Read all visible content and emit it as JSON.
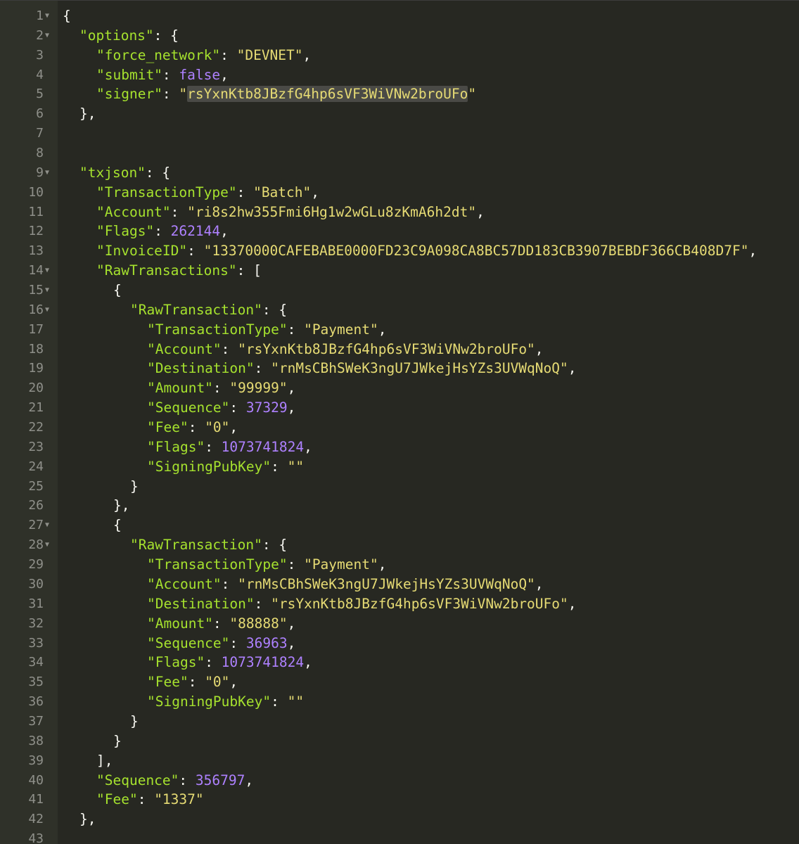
{
  "editor": {
    "theme_colors": {
      "background": "#272822",
      "gutter": "#2f3129",
      "line_number": "#8f908a",
      "key": "#a6e22e",
      "string": "#e6db74",
      "number": "#ae81ff",
      "punctuation": "#f8f8f2",
      "selection": "#4a4a46"
    },
    "lines": [
      {
        "n": "1",
        "fold": true,
        "indent": 0,
        "tokens": [
          {
            "t": "p",
            "v": "{"
          }
        ]
      },
      {
        "n": "2",
        "fold": true,
        "indent": 1,
        "tokens": [
          {
            "t": "k",
            "v": "\"options\""
          },
          {
            "t": "p",
            "v": ": {"
          }
        ]
      },
      {
        "n": "3",
        "indent": 2,
        "tokens": [
          {
            "t": "k",
            "v": "\"force_network\""
          },
          {
            "t": "p",
            "v": ": "
          },
          {
            "t": "s",
            "v": "\"DEVNET\""
          },
          {
            "t": "p",
            "v": ","
          }
        ]
      },
      {
        "n": "4",
        "indent": 2,
        "tokens": [
          {
            "t": "k",
            "v": "\"submit\""
          },
          {
            "t": "p",
            "v": ": "
          },
          {
            "t": "n",
            "v": "false"
          },
          {
            "t": "p",
            "v": ","
          }
        ]
      },
      {
        "n": "5",
        "indent": 2,
        "tokens": [
          {
            "t": "k",
            "v": "\"signer\""
          },
          {
            "t": "p",
            "v": ": "
          },
          {
            "t": "s",
            "v": "\""
          },
          {
            "t": "s",
            "v": "rsYxnKtb8JBzfG4hp6sVF3WiVNw2broUFo",
            "hl": true
          },
          {
            "t": "s",
            "v": "\""
          }
        ]
      },
      {
        "n": "6",
        "indent": 1,
        "tokens": [
          {
            "t": "p",
            "v": "},"
          }
        ]
      },
      {
        "n": "7",
        "indent": 0,
        "tokens": []
      },
      {
        "n": "8",
        "indent": 0,
        "tokens": []
      },
      {
        "n": "9",
        "fold": true,
        "indent": 1,
        "tokens": [
          {
            "t": "k",
            "v": "\"txjson\""
          },
          {
            "t": "p",
            "v": ": {"
          }
        ]
      },
      {
        "n": "10",
        "indent": 2,
        "tokens": [
          {
            "t": "k",
            "v": "\"TransactionType\""
          },
          {
            "t": "p",
            "v": ": "
          },
          {
            "t": "s",
            "v": "\"Batch\""
          },
          {
            "t": "p",
            "v": ","
          }
        ]
      },
      {
        "n": "11",
        "indent": 2,
        "tokens": [
          {
            "t": "k",
            "v": "\"Account\""
          },
          {
            "t": "p",
            "v": ": "
          },
          {
            "t": "s",
            "v": "\"ri8s2hw355Fmi6Hg1w2wGLu8zKmA6h2dt\""
          },
          {
            "t": "p",
            "v": ","
          }
        ]
      },
      {
        "n": "12",
        "indent": 2,
        "tokens": [
          {
            "t": "k",
            "v": "\"Flags\""
          },
          {
            "t": "p",
            "v": ": "
          },
          {
            "t": "n",
            "v": "262144"
          },
          {
            "t": "p",
            "v": ","
          }
        ]
      },
      {
        "n": "13",
        "indent": 2,
        "tokens": [
          {
            "t": "k",
            "v": "\"InvoiceID\""
          },
          {
            "t": "p",
            "v": ": "
          },
          {
            "t": "s",
            "v": "\"13370000CAFEBABE0000FD23C9A098CA8BC57DD183CB3907BEBDF366CB408D7F\""
          },
          {
            "t": "p",
            "v": ","
          }
        ]
      },
      {
        "n": "14",
        "fold": true,
        "indent": 2,
        "tokens": [
          {
            "t": "k",
            "v": "\"RawTransactions\""
          },
          {
            "t": "p",
            "v": ": ["
          }
        ]
      },
      {
        "n": "15",
        "fold": true,
        "indent": 3,
        "tokens": [
          {
            "t": "p",
            "v": "{"
          }
        ]
      },
      {
        "n": "16",
        "fold": true,
        "indent": 4,
        "tokens": [
          {
            "t": "k",
            "v": "\"RawTransaction\""
          },
          {
            "t": "p",
            "v": ": {"
          }
        ]
      },
      {
        "n": "17",
        "indent": 5,
        "tokens": [
          {
            "t": "k",
            "v": "\"TransactionType\""
          },
          {
            "t": "p",
            "v": ": "
          },
          {
            "t": "s",
            "v": "\"Payment\""
          },
          {
            "t": "p",
            "v": ","
          }
        ]
      },
      {
        "n": "18",
        "indent": 5,
        "tokens": [
          {
            "t": "k",
            "v": "\"Account\""
          },
          {
            "t": "p",
            "v": ": "
          },
          {
            "t": "s",
            "v": "\"rsYxnKtb8JBzfG4hp6sVF3WiVNw2broUFo\""
          },
          {
            "t": "p",
            "v": ","
          }
        ]
      },
      {
        "n": "19",
        "indent": 5,
        "tokens": [
          {
            "t": "k",
            "v": "\"Destination\""
          },
          {
            "t": "p",
            "v": ": "
          },
          {
            "t": "s",
            "v": "\"rnMsCBhSWeK3ngU7JWkejHsYZs3UVWqNoQ\""
          },
          {
            "t": "p",
            "v": ","
          }
        ]
      },
      {
        "n": "20",
        "indent": 5,
        "tokens": [
          {
            "t": "k",
            "v": "\"Amount\""
          },
          {
            "t": "p",
            "v": ": "
          },
          {
            "t": "s",
            "v": "\"99999\""
          },
          {
            "t": "p",
            "v": ","
          }
        ]
      },
      {
        "n": "21",
        "indent": 5,
        "tokens": [
          {
            "t": "k",
            "v": "\"Sequence\""
          },
          {
            "t": "p",
            "v": ": "
          },
          {
            "t": "n",
            "v": "37329"
          },
          {
            "t": "p",
            "v": ","
          }
        ]
      },
      {
        "n": "22",
        "indent": 5,
        "tokens": [
          {
            "t": "k",
            "v": "\"Fee\""
          },
          {
            "t": "p",
            "v": ": "
          },
          {
            "t": "s",
            "v": "\"0\""
          },
          {
            "t": "p",
            "v": ","
          }
        ]
      },
      {
        "n": "23",
        "indent": 5,
        "tokens": [
          {
            "t": "k",
            "v": "\"Flags\""
          },
          {
            "t": "p",
            "v": ": "
          },
          {
            "t": "n",
            "v": "1073741824"
          },
          {
            "t": "p",
            "v": ","
          }
        ]
      },
      {
        "n": "24",
        "indent": 5,
        "tokens": [
          {
            "t": "k",
            "v": "\"SigningPubKey\""
          },
          {
            "t": "p",
            "v": ": "
          },
          {
            "t": "s",
            "v": "\"\""
          }
        ]
      },
      {
        "n": "25",
        "indent": 4,
        "tokens": [
          {
            "t": "p",
            "v": "}"
          }
        ]
      },
      {
        "n": "26",
        "indent": 3,
        "tokens": [
          {
            "t": "p",
            "v": "},"
          }
        ]
      },
      {
        "n": "27",
        "fold": true,
        "indent": 3,
        "tokens": [
          {
            "t": "p",
            "v": "{"
          }
        ]
      },
      {
        "n": "28",
        "fold": true,
        "indent": 4,
        "tokens": [
          {
            "t": "k",
            "v": "\"RawTransaction\""
          },
          {
            "t": "p",
            "v": ": {"
          }
        ]
      },
      {
        "n": "29",
        "indent": 5,
        "tokens": [
          {
            "t": "k",
            "v": "\"TransactionType\""
          },
          {
            "t": "p",
            "v": ": "
          },
          {
            "t": "s",
            "v": "\"Payment\""
          },
          {
            "t": "p",
            "v": ","
          }
        ]
      },
      {
        "n": "30",
        "indent": 5,
        "tokens": [
          {
            "t": "k",
            "v": "\"Account\""
          },
          {
            "t": "p",
            "v": ": "
          },
          {
            "t": "s",
            "v": "\"rnMsCBhSWeK3ngU7JWkejHsYZs3UVWqNoQ\""
          },
          {
            "t": "p",
            "v": ","
          }
        ]
      },
      {
        "n": "31",
        "indent": 5,
        "tokens": [
          {
            "t": "k",
            "v": "\"Destination\""
          },
          {
            "t": "p",
            "v": ": "
          },
          {
            "t": "s",
            "v": "\"rsYxnKtb8JBzfG4hp6sVF3WiVNw2broUFo\""
          },
          {
            "t": "p",
            "v": ","
          }
        ]
      },
      {
        "n": "32",
        "indent": 5,
        "tokens": [
          {
            "t": "k",
            "v": "\"Amount\""
          },
          {
            "t": "p",
            "v": ": "
          },
          {
            "t": "s",
            "v": "\"88888\""
          },
          {
            "t": "p",
            "v": ","
          }
        ]
      },
      {
        "n": "33",
        "indent": 5,
        "tokens": [
          {
            "t": "k",
            "v": "\"Sequence\""
          },
          {
            "t": "p",
            "v": ": "
          },
          {
            "t": "n",
            "v": "36963"
          },
          {
            "t": "p",
            "v": ","
          }
        ]
      },
      {
        "n": "34",
        "indent": 5,
        "tokens": [
          {
            "t": "k",
            "v": "\"Flags\""
          },
          {
            "t": "p",
            "v": ": "
          },
          {
            "t": "n",
            "v": "1073741824"
          },
          {
            "t": "p",
            "v": ","
          }
        ]
      },
      {
        "n": "35",
        "indent": 5,
        "tokens": [
          {
            "t": "k",
            "v": "\"Fee\""
          },
          {
            "t": "p",
            "v": ": "
          },
          {
            "t": "s",
            "v": "\"0\""
          },
          {
            "t": "p",
            "v": ","
          }
        ]
      },
      {
        "n": "36",
        "indent": 5,
        "tokens": [
          {
            "t": "k",
            "v": "\"SigningPubKey\""
          },
          {
            "t": "p",
            "v": ": "
          },
          {
            "t": "s",
            "v": "\"\""
          }
        ]
      },
      {
        "n": "37",
        "indent": 4,
        "tokens": [
          {
            "t": "p",
            "v": "}"
          }
        ]
      },
      {
        "n": "38",
        "indent": 3,
        "tokens": [
          {
            "t": "p",
            "v": "}"
          }
        ]
      },
      {
        "n": "39",
        "indent": 2,
        "tokens": [
          {
            "t": "p",
            "v": "],"
          }
        ]
      },
      {
        "n": "40",
        "indent": 2,
        "tokens": [
          {
            "t": "k",
            "v": "\"Sequence\""
          },
          {
            "t": "p",
            "v": ": "
          },
          {
            "t": "n",
            "v": "356797"
          },
          {
            "t": "p",
            "v": ","
          }
        ]
      },
      {
        "n": "41",
        "indent": 2,
        "tokens": [
          {
            "t": "k",
            "v": "\"Fee\""
          },
          {
            "t": "p",
            "v": ": "
          },
          {
            "t": "s",
            "v": "\"1337\""
          }
        ]
      },
      {
        "n": "42",
        "indent": 1,
        "tokens": [
          {
            "t": "p",
            "v": "},"
          }
        ]
      },
      {
        "n": "43",
        "indent": 0,
        "tokens": []
      }
    ]
  }
}
